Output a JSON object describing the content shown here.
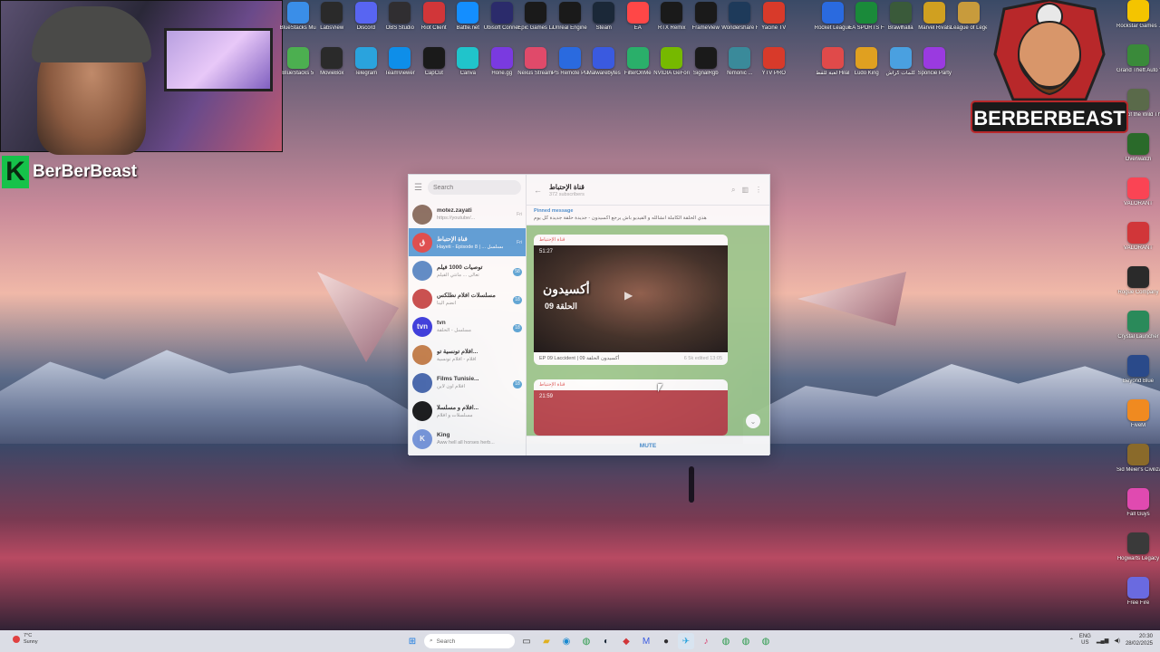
{
  "streamer": {
    "tag_letter": "K",
    "tag_name": "BerBerBeast",
    "logo_text": "BERBERBEAST"
  },
  "desktop_icons_top": [
    {
      "label": "BlueStacks Multi-Insta...",
      "icon": "bluestacks-icon",
      "color": "#3a8ee8"
    },
    {
      "label": "LabsView",
      "icon": "labsview-icon",
      "color": "#2a2a2a"
    },
    {
      "label": "Discord",
      "icon": "discord-icon",
      "color": "#5865f2"
    },
    {
      "label": "OBS Studio",
      "icon": "obs-icon",
      "color": "#302e31"
    },
    {
      "label": "Riot Client",
      "icon": "riot-icon",
      "color": "#d13639"
    },
    {
      "label": "Battle.net",
      "icon": "battlenet-icon",
      "color": "#148eff"
    },
    {
      "label": "Ubisoft Connect",
      "icon": "ubisoft-icon",
      "color": "#2b2b6b"
    },
    {
      "label": "Epic Games Launcher",
      "icon": "epic-icon",
      "color": "#1a1a1a"
    },
    {
      "label": "Unreal Engine",
      "icon": "unreal-icon",
      "color": "#1a1a1a"
    },
    {
      "label": "Steam",
      "icon": "steam-icon",
      "color": "#1b2838"
    },
    {
      "label": "EA",
      "icon": "ea-icon",
      "color": "#ff4747"
    },
    {
      "label": "RTX Remix",
      "icon": "rtx-remix-icon",
      "color": "#1a1a1a"
    },
    {
      "label": "FrameView",
      "icon": "frameview-icon",
      "color": "#1a1a1a"
    },
    {
      "label": "Wondershare Filmora 11",
      "icon": "filmora-icon",
      "color": "#1e3a5a"
    },
    {
      "label": "Yacine TV",
      "icon": "yacine-tv-icon",
      "color": "#d83a2a"
    }
  ],
  "desktop_icons_row2": [
    {
      "label": "BlueStacks 5",
      "icon": "bluestacks5-icon",
      "color": "#4caf50"
    },
    {
      "label": "MovieBox",
      "icon": "moviebox-icon",
      "color": "#2a2a2a"
    },
    {
      "label": "Telegram",
      "icon": "telegram-icon",
      "color": "#2aa3dd"
    },
    {
      "label": "TeamViewer",
      "icon": "teamviewer-icon",
      "color": "#0e8ee9"
    },
    {
      "label": "CapCut",
      "icon": "capcut-icon",
      "color": "#1a1a1a"
    },
    {
      "label": "Canva",
      "icon": "canva-icon",
      "color": "#20c4cb"
    },
    {
      "label": "Hone.gg",
      "icon": "hone-icon",
      "color": "#7a3ae0"
    },
    {
      "label": "Nexus Streamin...",
      "icon": "nexus-icon",
      "color": "#e04a6a"
    },
    {
      "label": "PS Remote Play",
      "icon": "ps-remote-icon",
      "color": "#2a6adf"
    },
    {
      "label": "Malwarebytes",
      "icon": "malwarebytes-icon",
      "color": "#3a5ae0"
    },
    {
      "label": "FilterOnMe",
      "icon": "filteronme-icon",
      "color": "#2aaf6a"
    },
    {
      "label": "NVIDIA GeForce...",
      "icon": "nvidia-icon",
      "color": "#76b900"
    },
    {
      "label": "SignalRgb",
      "icon": "signalrgb-icon",
      "color": "#1a1a1a"
    },
    {
      "label": "Nimonic ...",
      "icon": "nimonic-icon",
      "color": "#3a8a9a"
    },
    {
      "label": "YTV PRO",
      "icon": "ytv-pro-icon",
      "color": "#d83a2a"
    }
  ],
  "desktop_icons_top_right": [
    {
      "label": "Rocket League®",
      "icon": "rocket-league-icon",
      "color": "#2a6adf"
    },
    {
      "label": "EA SPORTS FC 25",
      "icon": "fc25-icon",
      "color": "#1a8a3a"
    },
    {
      "label": "Brawlhalla",
      "icon": "brawlhalla-icon",
      "color": "#3a5a3a"
    },
    {
      "label": "Marvel Rivals",
      "icon": "marvel-rivals-icon",
      "color": "#d0a020"
    },
    {
      "label": "League of Legends",
      "icon": "lol-icon",
      "color": "#c89b3c"
    }
  ],
  "desktop_icons_row2_right": [
    {
      "label": "لعبة للقط Hilal",
      "icon": "game-a-icon",
      "color": "#e04a4a"
    },
    {
      "label": "Ludo King",
      "icon": "ludo-king-icon",
      "color": "#e0a020"
    },
    {
      "label": "كلمات كراش",
      "icon": "word-crash-icon",
      "color": "#4aa0e0"
    },
    {
      "label": "Sponcie Party",
      "icon": "sponcie-icon",
      "color": "#9a3ae0"
    }
  ],
  "desktop_icons_right_column": [
    {
      "label": "Rockstar Games ...",
      "icon": "rockstar-icon",
      "color": "#f4c400"
    },
    {
      "label": "Grand Theft Auto V En...",
      "icon": "gta-icon",
      "color": "#3a8a3a"
    },
    {
      "label": "Call of the Wild Th...",
      "icon": "cotw-icon",
      "color": "#5a6a4a"
    },
    {
      "label": "Overwatch",
      "icon": "overwatch-icon",
      "color": "#2a6a2a"
    },
    {
      "label": "VALORANT",
      "icon": "valorant-icon",
      "color": "#fa4454"
    },
    {
      "label": "VALORANT",
      "icon": "valorant-icon",
      "color": "#d13639"
    },
    {
      "label": "Rogue Company",
      "icon": "rogue-company-icon",
      "color": "#2a2a2a"
    },
    {
      "label": "Crystal Launcher",
      "icon": "crystal-icon",
      "color": "#2a8a5a"
    },
    {
      "label": "Beyond Blue",
      "icon": "beyond-blue-icon",
      "color": "#2a4a8a"
    },
    {
      "label": "FiveM",
      "icon": "fivem-icon",
      "color": "#f08a20"
    },
    {
      "label": "Sid Meier's Civilization VI",
      "icon": "civ-icon",
      "color": "#8a6a2a"
    },
    {
      "label": "Fall Guys",
      "icon": "fall-guys-icon",
      "color": "#e04ab0"
    },
    {
      "label": "Hogwarts Legacy",
      "icon": "hogwarts-icon",
      "color": "#3a3a3a"
    },
    {
      "label": "Free Fire",
      "icon": "free-fire-icon",
      "color": "#6a6ae0"
    }
  ],
  "telegram": {
    "search_placeholder": "Search",
    "chats": [
      {
        "name": "motez.zayati",
        "preview": "https://youtube/...",
        "time": "Fri",
        "badge": "",
        "avatar_color": "#8a7060",
        "avatar_text": "",
        "active": false
      },
      {
        "name": "قناة الإحتباط",
        "preview": "Hayeti - Episode 8 | ... مسلسل",
        "time": "Fri",
        "badge": "",
        "avatar_color": "#e04a4a",
        "avatar_text": "ق",
        "active": true
      },
      {
        "name": "توصيات 1000 فيلم",
        "preview": "تعالى ... مانتي الفيلم",
        "time": "",
        "badge": "58",
        "avatar_color": "#5a8ac8",
        "avatar_text": "",
        "active": false
      },
      {
        "name": "مسلسلات افلام نطلكس",
        "preview": "انضم الينا",
        "time": "",
        "badge": "18",
        "avatar_color": "#c84a4a",
        "avatar_text": "",
        "active": false
      },
      {
        "name": "tvn",
        "preview": "مسلسل - الحلقة",
        "time": "",
        "badge": "18",
        "avatar_color": "#3a3ae0",
        "avatar_text": "tvn",
        "active": false
      },
      {
        "name": "افلام تونسية تو...",
        "preview": "أفلام - أفلام تونسية",
        "time": "",
        "badge": "",
        "avatar_color": "#c8804a",
        "avatar_text": "",
        "active": false
      },
      {
        "name": "Films Tunisie...",
        "preview": "أفلام أون لاين",
        "time": "",
        "badge": "18",
        "avatar_color": "#4a6ab0",
        "avatar_text": "",
        "active": false
      },
      {
        "name": "افلام و مسلسلا...",
        "preview": "مسلسلات و أفلام",
        "time": "",
        "badge": "",
        "avatar_color": "#1a1a1a",
        "avatar_text": "",
        "active": false
      },
      {
        "name": "King",
        "preview": "Aww hell all horses herb...",
        "time": "",
        "badge": "",
        "avatar_color": "#7a9ae0",
        "avatar_text": "K",
        "active": false
      }
    ],
    "channel_title": "قناة الإحتباط",
    "channel_subscribers": "372 subscribers",
    "pinned_label": "Pinned message",
    "pinned_text": "هذي الحلقة الكاملة انشالله و الفيديو باش يرجع اكسيدون - جديدة حلقة جديدة كل يوم",
    "messages": [
      {
        "sender": "قناة الإحتباط",
        "duration": "51:27",
        "overlay_title": "أكسيدون",
        "overlay_episode": "الحلقة 09",
        "caption": "EP 09 Laccident | أكسيدون الحلقة 09",
        "views": "6 5k edited 13:05"
      },
      {
        "sender": "قناة الإحتباط",
        "duration": "21:59"
      }
    ],
    "mute_label": "MUTE"
  },
  "taskbar": {
    "weather_temp": "7°C",
    "weather_desc": "Sunny",
    "search_placeholder": "Search",
    "language": "ENG",
    "lang_sub": "US",
    "time": "20:30",
    "date": "28/02/2025"
  }
}
